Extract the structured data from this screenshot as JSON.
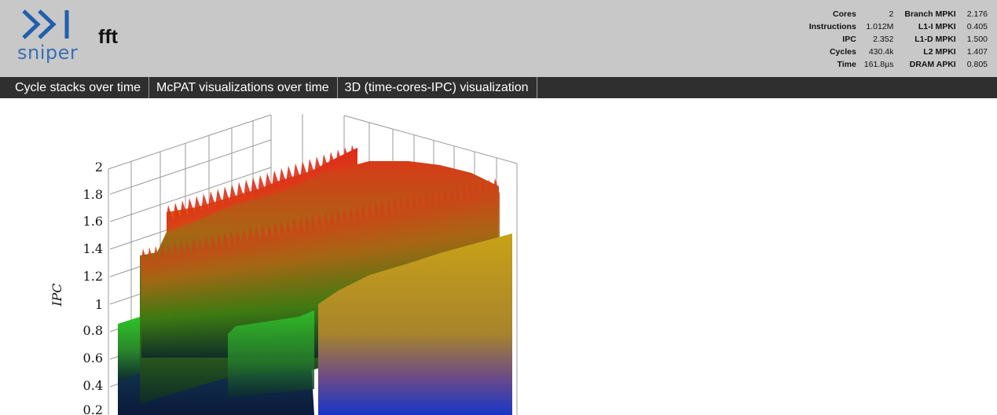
{
  "header": {
    "logo_text": "sniper",
    "app_title": "fft"
  },
  "stats": [
    {
      "label": "Cores",
      "value": "2",
      "label2": "Branch MPKI",
      "value2": "2.176"
    },
    {
      "label": "Instructions",
      "value": "1.012M",
      "label2": "L1-I MPKI",
      "value2": "0.405"
    },
    {
      "label": "IPC",
      "value": "2.352",
      "label2": "L1-D MPKI",
      "value2": "1.500"
    },
    {
      "label": "Cycles",
      "value": "430.4k",
      "label2": "L2 MPKI",
      "value2": "1.407"
    },
    {
      "label": "Time",
      "value": "161.8µs",
      "label2": "DRAM APKI",
      "value2": "0.805"
    }
  ],
  "tabs": [
    {
      "label": "Cycle stacks over time"
    },
    {
      "label": "McPAT visualizations over time"
    },
    {
      "label": "3D (time-cores-IPC) visualization"
    }
  ],
  "plot": {
    "axis_title": "IPC",
    "ticks": [
      "2",
      "1.8",
      "1.6",
      "1.4",
      "1.2",
      "1",
      "0.8",
      "0.6",
      "0.4",
      "0.2"
    ]
  },
  "colors": {
    "header_bg": "#c8c8c8",
    "tabbar_bg": "#2f2f2f",
    "logo_blue": "#1f5fae"
  },
  "icons": {
    "logo": "sniper-logo-icon"
  }
}
